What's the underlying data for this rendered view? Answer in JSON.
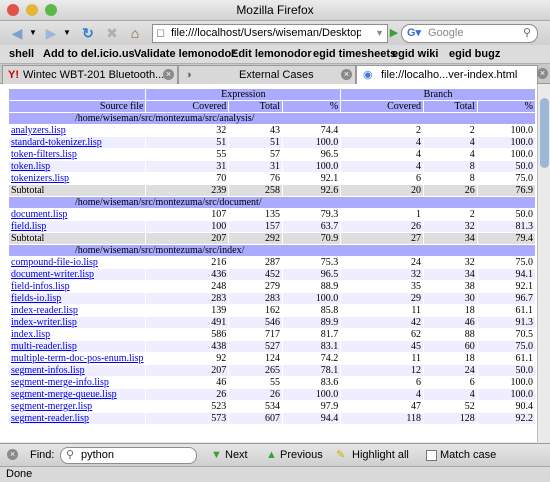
{
  "window": {
    "title": "Mozilla Firefox"
  },
  "nav": {
    "url": "file:///localhost/Users/wiseman/Desktop/c",
    "search_placeholder": "Google"
  },
  "bookmarks": [
    "shell",
    "Add to del.icio.us",
    "Validate lemonodor",
    "Edit lemonodor",
    "egid timesheets",
    "egid wiki",
    "egid bugz"
  ],
  "tabs": [
    {
      "label": "Wintec WBT-201 Bluetooth..."
    },
    {
      "label": "External Cases"
    },
    {
      "label": "file://localho...ver-index.html"
    }
  ],
  "table": {
    "group_headers": {
      "expression": "Expression",
      "branch": "Branch"
    },
    "columns": [
      "Source file",
      "Covered",
      "Total",
      "%",
      "Covered",
      "Total",
      "%"
    ],
    "rows": [
      {
        "kind": "dir",
        "name": "/home/wiseman/src/montezuma/src/analysis/"
      },
      {
        "kind": "file",
        "name": "analyzers.lisp",
        "vals": [
          "32",
          "43",
          "74.4",
          "2",
          "2",
          "100.0"
        ]
      },
      {
        "kind": "file",
        "name": "standard-tokenizer.lisp",
        "vals": [
          "51",
          "51",
          "100.0",
          "4",
          "4",
          "100.0"
        ]
      },
      {
        "kind": "file",
        "name": "token-filters.lisp",
        "vals": [
          "55",
          "57",
          "96.5",
          "4",
          "4",
          "100.0"
        ]
      },
      {
        "kind": "file",
        "name": "token.lisp",
        "vals": [
          "31",
          "31",
          "100.0",
          "4",
          "8",
          "50.0"
        ]
      },
      {
        "kind": "file",
        "name": "tokenizers.lisp",
        "vals": [
          "70",
          "76",
          "92.1",
          "6",
          "8",
          "75.0"
        ]
      },
      {
        "kind": "subtotal",
        "name": "Subtotal",
        "vals": [
          "239",
          "258",
          "92.6",
          "20",
          "26",
          "76.9"
        ]
      },
      {
        "kind": "dir",
        "name": "/home/wiseman/src/montezuma/src/document/"
      },
      {
        "kind": "file",
        "name": "document.lisp",
        "vals": [
          "107",
          "135",
          "79.3",
          "1",
          "2",
          "50.0"
        ]
      },
      {
        "kind": "file",
        "name": "field.lisp",
        "vals": [
          "100",
          "157",
          "63.7",
          "26",
          "32",
          "81.3"
        ]
      },
      {
        "kind": "subtotal",
        "name": "Subtotal",
        "vals": [
          "207",
          "292",
          "70.9",
          "27",
          "34",
          "79.4"
        ]
      },
      {
        "kind": "dir",
        "name": "/home/wiseman/src/montezuma/src/index/"
      },
      {
        "kind": "file",
        "name": "compound-file-io.lisp",
        "vals": [
          "216",
          "287",
          "75.3",
          "24",
          "32",
          "75.0"
        ]
      },
      {
        "kind": "file",
        "name": "document-writer.lisp",
        "vals": [
          "436",
          "452",
          "96.5",
          "32",
          "34",
          "94.1"
        ]
      },
      {
        "kind": "file",
        "name": "field-infos.lisp",
        "vals": [
          "248",
          "279",
          "88.9",
          "35",
          "38",
          "92.1"
        ]
      },
      {
        "kind": "file",
        "name": "fields-io.lisp",
        "vals": [
          "283",
          "283",
          "100.0",
          "29",
          "30",
          "96.7"
        ]
      },
      {
        "kind": "file",
        "name": "index-reader.lisp",
        "vals": [
          "139",
          "162",
          "85.8",
          "11",
          "18",
          "61.1"
        ]
      },
      {
        "kind": "file",
        "name": "index-writer.lisp",
        "vals": [
          "491",
          "546",
          "89.9",
          "42",
          "46",
          "91.3"
        ]
      },
      {
        "kind": "file",
        "name": "index.lisp",
        "vals": [
          "586",
          "717",
          "81.7",
          "62",
          "88",
          "70.5"
        ]
      },
      {
        "kind": "file",
        "name": "multi-reader.lisp",
        "vals": [
          "438",
          "527",
          "83.1",
          "45",
          "60",
          "75.0"
        ]
      },
      {
        "kind": "file",
        "name": "multiple-term-doc-pos-enum.lisp",
        "vals": [
          "92",
          "124",
          "74.2",
          "11",
          "18",
          "61.1"
        ]
      },
      {
        "kind": "file",
        "name": "segment-infos.lisp",
        "vals": [
          "207",
          "265",
          "78.1",
          "12",
          "24",
          "50.0"
        ]
      },
      {
        "kind": "file",
        "name": "segment-merge-info.lisp",
        "vals": [
          "46",
          "55",
          "83.6",
          "6",
          "6",
          "100.0"
        ]
      },
      {
        "kind": "file",
        "name": "segment-merge-queue.lisp",
        "vals": [
          "26",
          "26",
          "100.0",
          "4",
          "4",
          "100.0"
        ]
      },
      {
        "kind": "file",
        "name": "segment-merger.lisp",
        "vals": [
          "523",
          "534",
          "97.9",
          "47",
          "52",
          "90.4"
        ]
      },
      {
        "kind": "file",
        "name": "segment-reader.lisp",
        "vals": [
          "573",
          "607",
          "94.4",
          "118",
          "128",
          "92.2"
        ]
      }
    ]
  },
  "findbar": {
    "label": "Find:",
    "query": "python",
    "next": "Next",
    "previous": "Previous",
    "highlight": "Highlight all",
    "match_case": "Match case"
  },
  "status": {
    "text": "Done"
  }
}
